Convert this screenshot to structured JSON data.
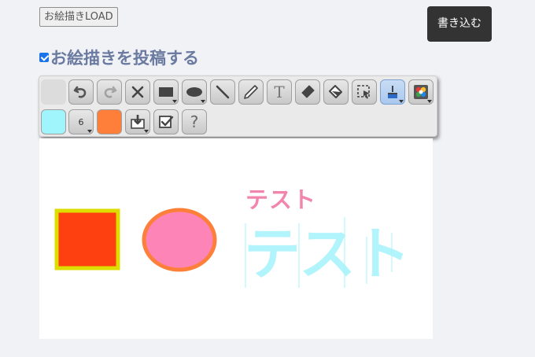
{
  "load_button": {
    "label": "お絵描きLOAD"
  },
  "write_button": {
    "label": "書き込む"
  },
  "post_option": {
    "label": "お絵描きを投稿する",
    "checked": true
  },
  "toolbar": {
    "pen_size": "6",
    "help_label": "?",
    "text_tool_glyph": "T",
    "colors": {
      "primary": "#a0f5fc",
      "secondary": "#fe7f3a"
    },
    "tools_row1": [
      "blank",
      "undo-icon",
      "redo-icon",
      "clear-icon",
      "rectangle-icon",
      "ellipse-icon",
      "line-icon",
      "pen-icon",
      "text-icon",
      "eraser-icon",
      "fill-icon",
      "select-icon",
      "brush-icon",
      "palette-icon"
    ],
    "tools_row2": [
      "color-primary-swatch",
      "size-icon",
      "color-secondary-swatch",
      "save-icon",
      "checkbox-icon",
      "help-icon"
    ]
  },
  "canvas": {
    "text_small": "テスト",
    "text_large": "テスト",
    "colors": {
      "square_fill": "#fe4010",
      "square_border": "#dedd00",
      "ellipse_fill": "#fd84b7",
      "ellipse_border": "#fe7f3a",
      "text_small": "#f285ad",
      "text_large": "#aaf3fb"
    }
  }
}
